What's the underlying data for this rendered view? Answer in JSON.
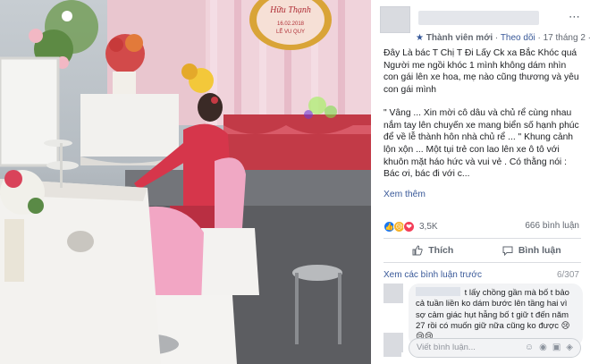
{
  "photo": {
    "sign_line1": "Hữu Thạnh",
    "sign_line2": "16.02.2018",
    "sign_line3": "LỄ VU QUY"
  },
  "post": {
    "membership": "Thành viên mới",
    "follow": "Theo dõi",
    "timestamp": "17 tháng 2",
    "more_icon": "⋯",
    "body_p1": "Đây Là bác T Chị T Đi Lấy Ck xa Bắc Khóc quá Người me ngồi khóc 1 mình không dám nhìn con gái lên xe hoa, mẹ nào cũng thương và yêu con gái mình",
    "body_p2": "\" Vâng ... Xin mời cô dâu và chủ rể cùng nhau nắm tay lên chuyến xe mang biển số hạnh phúc để về lễ thành hôn nhà chủ rể ... \" Khung cảnh lộn xộn ... Một tụi trẻ con lao lên xe ô tô với khuôn mặt háo hức và vui vẻ . Có thằng nói : Bác ơi, bác đi với c...",
    "see_more": "Xem thêm"
  },
  "stats": {
    "reactions": "3,5K",
    "comments": "666 bình luận"
  },
  "actions": {
    "like": "Thích",
    "comment": "Bình luận"
  },
  "comments": {
    "view_previous": "Xem các bình luận trước",
    "count": "6/307",
    "first_text": "t lấy chồng gần mà bố t bảo cả tuần liền ko dám bước lên tầng hai vì sợ cảm giác hụt hẫng bố t giữ t đến năm 27 rồi có muốn giữ nữa cũng ko được 😢😢😢",
    "write_placeholder": "Viết bình luận..."
  },
  "colors": {
    "link": "#385898",
    "like_blue": "#1877f2",
    "wall_pink": "#e8a7b8",
    "table_red": "#c23a47"
  }
}
